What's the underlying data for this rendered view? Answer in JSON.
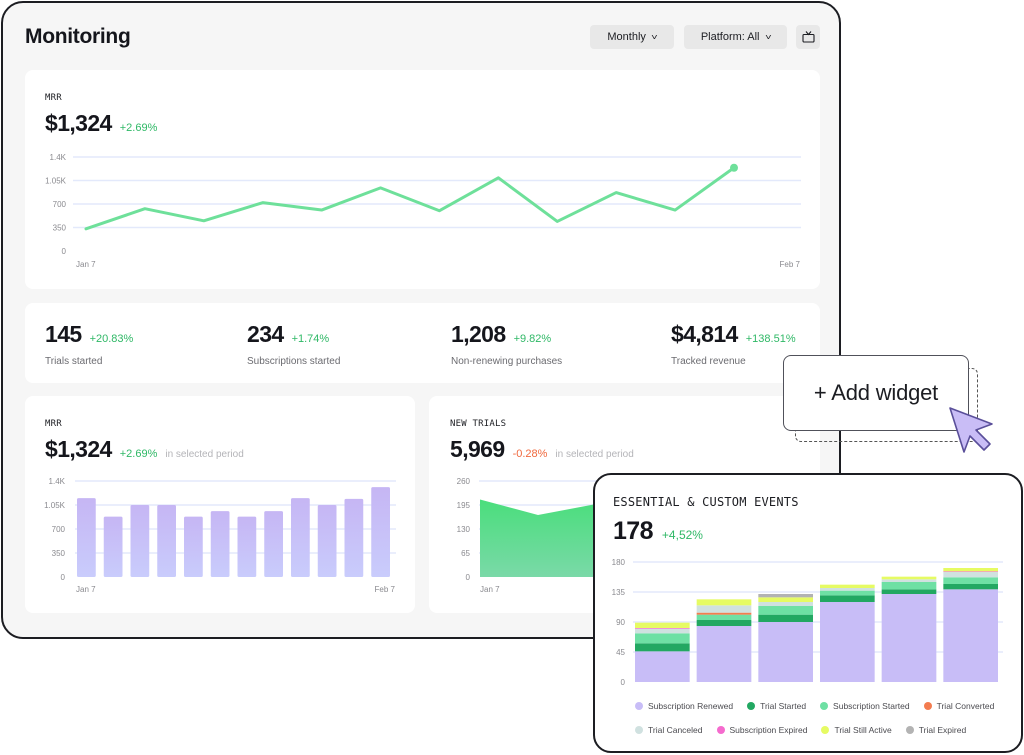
{
  "header": {
    "title": "Monitoring",
    "period_select": "Monthly",
    "platform_select": "Platform: All",
    "tv_icon": "tv-icon"
  },
  "mrr_line": {
    "label": "MRR",
    "value": "$1,324",
    "change": "+2.69%",
    "chart_data": {
      "type": "line",
      "title": "MRR",
      "x_start_label": "Jan 7",
      "x_end_label": "Feb 7",
      "ytick_labels": [
        "0",
        "350",
        "700",
        "1.05K",
        "1.4K"
      ],
      "ylim": [
        0,
        1400
      ],
      "color": "#6ee09a",
      "values": [
        330,
        630,
        450,
        720,
        610,
        940,
        600,
        1090,
        440,
        870,
        610,
        1240
      ]
    }
  },
  "stats": [
    {
      "value": "145",
      "change": "+20.83%",
      "label": "Trials started"
    },
    {
      "value": "234",
      "change": "+1.74%",
      "label": "Subscriptions started"
    },
    {
      "value": "1,208",
      "change": "+9.82%",
      "label": "Non-renewing purchases"
    },
    {
      "value": "$4,814",
      "change": "+138.51%",
      "label": "Tracked revenue"
    }
  ],
  "mrr_bars": {
    "label": "MRR",
    "value": "$1,324",
    "change": "+2.69%",
    "period_note": "in selected period",
    "chart_data": {
      "type": "bar",
      "title": "MRR",
      "x_start_label": "Jan 7",
      "x_end_label": "Feb 7",
      "ytick_labels": [
        "0",
        "350",
        "700",
        "1.05K",
        "1.4K"
      ],
      "ylim": [
        0,
        1400
      ],
      "values": [
        1150,
        880,
        1050,
        1050,
        880,
        960,
        880,
        960,
        1150,
        1050,
        1140,
        1310
      ]
    }
  },
  "new_trials": {
    "label": "NEW TRIALS",
    "value": "5,969",
    "change": "-0.28%",
    "period_note": "in selected period",
    "chart_data": {
      "type": "area",
      "title": "New Trials",
      "x_start_label": "Jan 7",
      "ytick_labels": [
        "0",
        "65",
        "130",
        "195",
        "260"
      ],
      "ylim": [
        0,
        260
      ],
      "values": [
        210,
        168,
        198
      ]
    }
  },
  "add_widget": {
    "label": "+ Add widget"
  },
  "events": {
    "label": "ESSENTIAL & CUSTOM EVENTS",
    "value": "178",
    "change": "+4,52%",
    "chart_data": {
      "type": "bar",
      "stacked": true,
      "title": "Essential & Custom Events",
      "ytick_labels": [
        "0",
        "45",
        "90",
        "135",
        "180"
      ],
      "ylim": [
        0,
        180
      ],
      "series": [
        {
          "name": "Subscription Renewed",
          "color": "#c8bdf7",
          "values": [
            46,
            84,
            90,
            120,
            132,
            139
          ]
        },
        {
          "name": "Trial Started",
          "color": "#22a862",
          "values": [
            12,
            9,
            11,
            10,
            7,
            8
          ]
        },
        {
          "name": "Subscription Started",
          "color": "#6ee0a4",
          "values": [
            15,
            8,
            13,
            7,
            11,
            10
          ]
        },
        {
          "name": "Trial Converted",
          "color": "#f37c4f",
          "values": [
            0,
            3,
            0,
            0,
            0,
            0
          ]
        },
        {
          "name": "Trial Canceled",
          "color": "#d0e1e0",
          "values": [
            7,
            11,
            6,
            4,
            4,
            8
          ]
        },
        {
          "name": "Subscription Expired",
          "color": "#f56bce",
          "values": [
            1,
            0,
            0,
            0,
            0,
            1
          ]
        },
        {
          "name": "Trial Still Active",
          "color": "#e6fb63",
          "values": [
            8,
            9,
            7,
            5,
            4,
            5
          ]
        },
        {
          "name": "Trial Expired",
          "color": "#b3b3b3",
          "values": [
            0,
            0,
            5,
            0,
            0,
            0
          ]
        }
      ]
    }
  }
}
